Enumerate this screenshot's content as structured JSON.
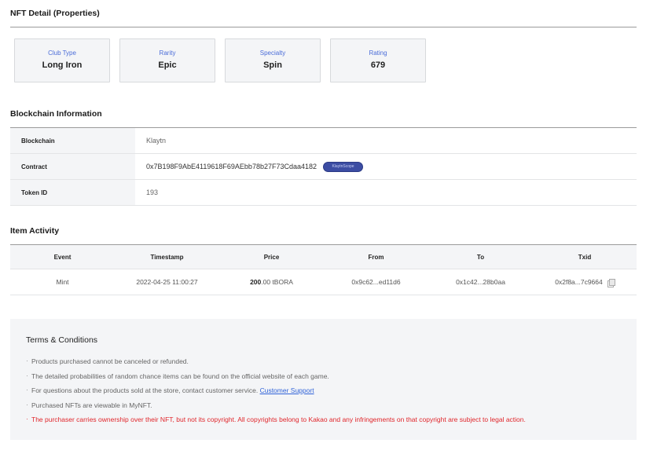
{
  "nft_detail": {
    "title": "NFT Detail (Properties)",
    "properties": [
      {
        "label": "Club Type",
        "value": "Long Iron"
      },
      {
        "label": "Rarity",
        "value": "Epic"
      },
      {
        "label": "Specialty",
        "value": "Spin"
      },
      {
        "label": "Rating",
        "value": "679"
      }
    ]
  },
  "blockchain": {
    "title": "Blockchain Information",
    "rows": [
      {
        "key": "Blockchain",
        "value": "Klaytn"
      },
      {
        "key": "Contract",
        "value": "0x7B198F9AbE4119618F69AEbb78b27F73Cdaa4182",
        "badge": "KlaytnScope"
      },
      {
        "key": "Token ID",
        "value": "193"
      }
    ]
  },
  "activity": {
    "title": "Item Activity",
    "columns": [
      "Event",
      "Timestamp",
      "Price",
      "From",
      "To",
      "Txid"
    ],
    "rows": [
      {
        "event": "Mint",
        "timestamp": "2022-04-25 11:00:27",
        "price_num": "200",
        "price_rest": ".00 tBORA",
        "from": "0x9c62...ed11d6",
        "to": "0x1c42...28b0aa",
        "txid": "0x2f8a...7c9664",
        "copy_icon": "copy-icon"
      }
    ]
  },
  "terms": {
    "title": "Terms & Conditions",
    "items": [
      "Products purchased cannot be canceled or refunded.",
      "The detailed probabilities of random chance items can be found on the official website of each game.",
      "For questions about the products sold at the store, contact customer service.",
      "Purchased NFTs are viewable in MyNFT.",
      "The purchaser carries ownership over their NFT, but not its copyright. All copyrights belong to Kakao and any infringements on that copyright are subject to legal action."
    ],
    "link_label": "Customer Support"
  },
  "colors": {
    "accent_label": "#4a6cd8",
    "warning": "#e0262b",
    "link": "#2f62d8",
    "badge": "#3c4da3"
  }
}
